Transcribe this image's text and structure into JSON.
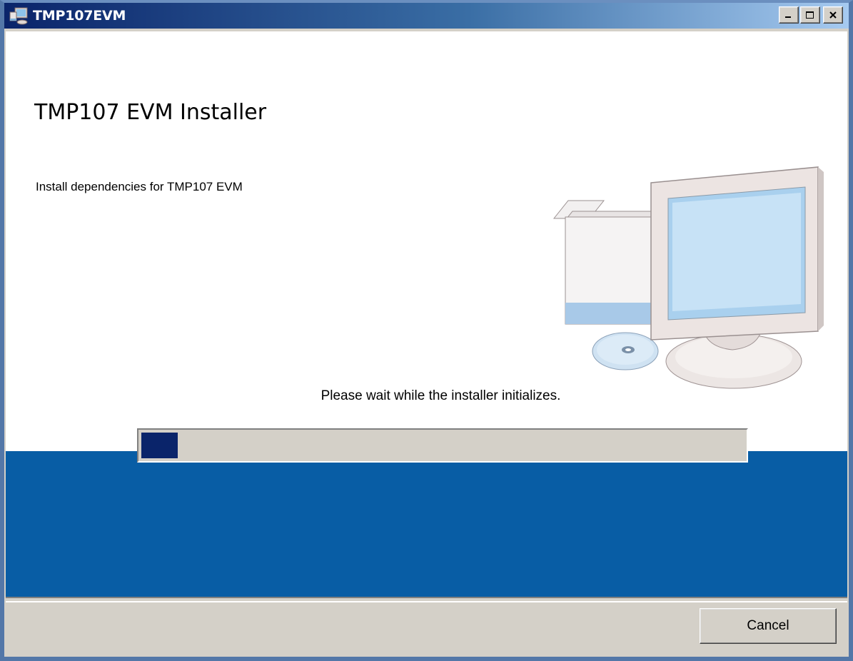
{
  "window": {
    "title": "TMP107EVM",
    "icon": "installer-computer-icon",
    "controls": [
      "minimize-icon",
      "maximize-icon",
      "close-icon"
    ]
  },
  "header": {
    "heading": "TMP107 EVM Installer",
    "subtitle": "Install dependencies for TMP107 EVM"
  },
  "status": {
    "message": "Please wait while the installer initializes.",
    "progress": 0.06
  },
  "footer": {
    "cancel_label": "Cancel"
  },
  "colors": {
    "band": "#085da5",
    "progress_fill": "#0a246a",
    "titlebar_start": "#0a246a"
  }
}
